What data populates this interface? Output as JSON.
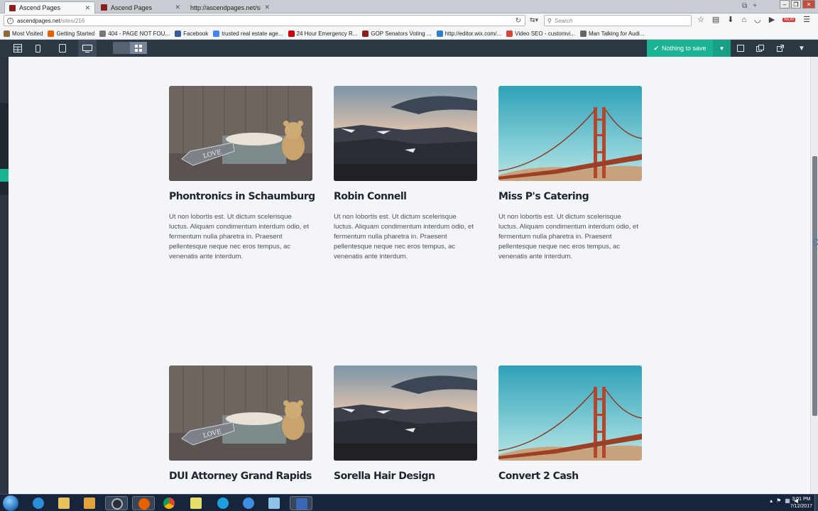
{
  "browser": {
    "tabs": [
      {
        "label": "Ascend Pages",
        "active": true
      },
      {
        "label": "Ascend Pages",
        "active": false
      },
      {
        "label": "http://ascendpages.net/sites/live",
        "active": false
      }
    ],
    "url_host": "ascendpages.net",
    "url_path": "/sites/216",
    "search_placeholder": "Search",
    "new_badge": "NEW",
    "bookmarks": [
      {
        "label": "Most Visited",
        "color": "#8a6d3b"
      },
      {
        "label": "Getting Started",
        "color": "#e66000"
      },
      {
        "label": "404 - PAGE NOT FOU...",
        "color": "#777777"
      },
      {
        "label": "Facebook",
        "color": "#3b5998"
      },
      {
        "label": "trusted real estate age...",
        "color": "#4285f4"
      },
      {
        "label": "24 Hour Emergency R...",
        "color": "#cc0000"
      },
      {
        "label": "GOP Senators Voting ...",
        "color": "#8b1e1e"
      },
      {
        "label": "http://editor.wix.com/...",
        "color": "#2d7fc9"
      },
      {
        "label": "Video SEO - customvi...",
        "color": "#d44638"
      },
      {
        "label": "Man Talking for Audi...",
        "color": "#666666"
      }
    ]
  },
  "editor": {
    "save_label": "Nothing to save",
    "accent": "#1ab394"
  },
  "cards": [
    {
      "title": "Phontronics in Schaumburg",
      "image": "teddy-bear-love-sign",
      "body": "Ut non lobortis est. Ut dictum scelerisque luctus. Aliquam condimentum interdum odio, et fermentum nulla pharetra in. Praesent pellentesque neque nec eros tempus, ac venenatis ante interdum."
    },
    {
      "title": "Robin Connell",
      "image": "mountain-sunset",
      "body": "Ut non lobortis est. Ut dictum scelerisque luctus. Aliquam condimentum interdum odio, et fermentum nulla pharetra in. Praesent pellentesque neque nec eros tempus, ac venenatis ante interdum."
    },
    {
      "title": "Miss P's Catering",
      "image": "golden-gate-bridge",
      "body": "Ut non lobortis est. Ut dictum scelerisque luctus. Aliquam condimentum interdum odio, et fermentum nulla pharetra in. Praesent pellentesque neque nec eros tempus, ac venenatis ante interdum."
    },
    {
      "title": "DUI Attorney Grand Rapids",
      "image": "teddy-bear-love-sign",
      "body": ""
    },
    {
      "title": "Sorella Hair Design",
      "image": "mountain-sunset",
      "body": ""
    },
    {
      "title": "Convert 2 Cash",
      "image": "golden-gate-bridge",
      "body": ""
    }
  ],
  "teddy_sign": "LOVE",
  "taskbar": {
    "time": "3:01 PM",
    "date": "7/12/2017"
  }
}
